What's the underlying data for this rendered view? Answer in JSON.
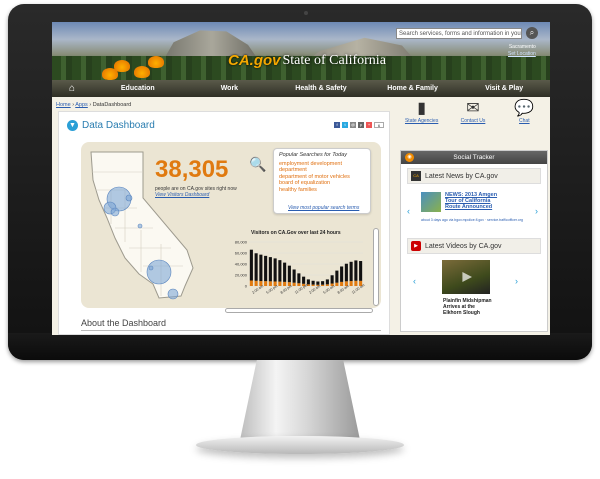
{
  "site": {
    "brand": "CA.gov",
    "state_name": "State of California",
    "search_placeholder": "Search services, forms and information in you",
    "location": "Sacramento",
    "set_location": "Set Location"
  },
  "nav": [
    "Education",
    "Work",
    "Health & Safety",
    "Home & Family",
    "Visit & Play"
  ],
  "breadcrumb": [
    "Home",
    "Apps",
    "DataDashboard"
  ],
  "dashboard": {
    "title": "Data Dashboard",
    "share_count": "6",
    "stat_number": "38,305",
    "stat_text": "people are on CA.gov sites right now",
    "stat_link": "View Visitors Dashboard",
    "popular_title": "Popular Searches for Today",
    "popular_searches": [
      "employment development",
      "department",
      "department of motor vehicles",
      "board of equalization",
      "healthy families"
    ],
    "popular_more": "View most popular search terms",
    "about": "About the Dashboard"
  },
  "chart_data": {
    "type": "bar",
    "title": "Visitors on CA.Gov over last 24 hours",
    "ylim": [
      0,
      80000
    ],
    "yticks": [
      "80,000",
      "60,000",
      "40,000",
      "20,000",
      "0"
    ],
    "xticks": [
      "2:00 am",
      "5:00 pm",
      "8:00 pm",
      "11:00 pm",
      "2:00 am",
      "5:00 am",
      "8:00 am",
      "11:00 am"
    ],
    "series": [
      {
        "values": [
          56000,
          50000,
          48000,
          46000,
          44000,
          42000,
          39000,
          35000,
          30000,
          24000,
          18000,
          13000,
          9000,
          7000,
          6000,
          6500,
          9000,
          15000,
          22000,
          28000,
          32000,
          35000,
          37000,
          36000
        ]
      },
      {
        "values": [
          10000,
          9500,
          9000,
          8800,
          8500,
          8200,
          8000,
          7500,
          7000,
          6000,
          5000,
          4000,
          3000,
          2500,
          2200,
          2300,
          3000,
          4500,
          6000,
          7500,
          8500,
          9000,
          9500,
          9400
        ]
      }
    ],
    "colors": [
      "#111111",
      "#e07a10"
    ]
  },
  "right": {
    "quick": [
      {
        "icon": "california-icon",
        "label": "State Agencies"
      },
      {
        "icon": "envelope-icon",
        "label": "Contact Us"
      },
      {
        "icon": "chat-icon",
        "label": "Chat"
      }
    ],
    "social_title": "Social Tracker",
    "news_header": "Latest News by CA.gov",
    "news_title": "NEWS: 2013 Amgen Tour of California Route Announced",
    "news_meta": "about 3 days ago via bgov.mpolice.fl.gov · service.trafficofficer.org",
    "video_header": "Latest Videos by CA.gov",
    "video_title": "Plainfin Midshipman Arrives at the Elkhorn Slough"
  },
  "colors": {
    "accent": "#e07a10",
    "link": "#2a5db0",
    "nav": "#3a3a2e"
  }
}
